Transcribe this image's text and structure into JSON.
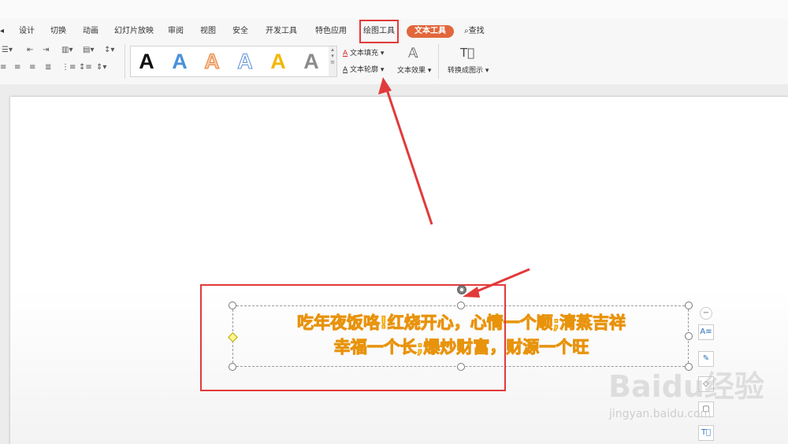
{
  "tabs": [
    {
      "label": "设计"
    },
    {
      "label": "切换"
    },
    {
      "label": "动画"
    },
    {
      "label": "幻灯片放映"
    },
    {
      "label": "审阅"
    },
    {
      "label": "视图"
    },
    {
      "label": "安全"
    },
    {
      "label": "开发工具"
    },
    {
      "label": "特色应用"
    },
    {
      "label": "绘图工具"
    },
    {
      "label": "文本工具"
    },
    {
      "label": "查找"
    }
  ],
  "ribbon": {
    "text_fill": "文本填充",
    "text_outline": "文本轮廓",
    "text_effect": "文本效果",
    "convert": "转换成图示",
    "style_glyph": "A",
    "style_colors": [
      "#111111",
      "#4a90d9",
      "#e8833a",
      "#5b8fd6",
      "#f2b705",
      "#8c8c8c"
    ]
  },
  "slide": {
    "text_line1": "吃年夜饭咯!红烧开心，心情一个顺;清蒸吉祥",
    "text_line2": "幸福一个长;爆炒财富，财源一个旺"
  },
  "watermark": {
    "main": "Baidu经验",
    "sub": "jingyan.baidu.com"
  },
  "colors": {
    "accent": "#e2673c",
    "annotation": "#e23a3a",
    "text_fill": "#ffd233"
  }
}
